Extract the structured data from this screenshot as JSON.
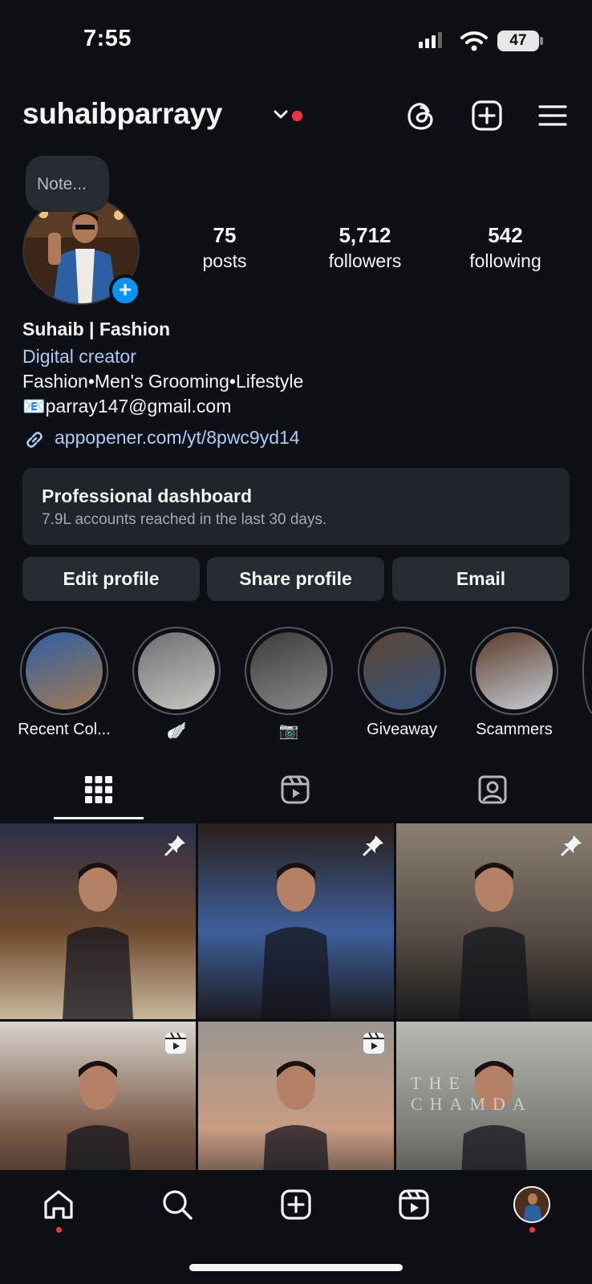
{
  "status_bar": {
    "time": "7:55",
    "battery": "47"
  },
  "header": {
    "username": "suhaibparrayy"
  },
  "note": {
    "placeholder": "Note..."
  },
  "stats": [
    {
      "value": "75",
      "label": "posts"
    },
    {
      "value": "5,712",
      "label": "followers"
    },
    {
      "value": "542",
      "label": "following"
    }
  ],
  "bio": {
    "name": "Suhaib | Fashion",
    "category": "Digital creator",
    "line1": "Fashion•Men's Grooming•Lifestyle",
    "line2": "📧parray147@gmail.com",
    "link": "appopener.com/yt/8pwc9yd14"
  },
  "dashboard": {
    "title": "Professional dashboard",
    "subtitle": "7.9L accounts reached in the last 30 days."
  },
  "buttons": {
    "edit": "Edit profile",
    "share": "Share profile",
    "email": "Email"
  },
  "highlights": [
    {
      "label": "Recent Col...",
      "colors": [
        "#2d5fa0",
        "#a37a55"
      ]
    },
    {
      "label": "🪽",
      "colors": [
        "#6b6f72",
        "#c9c6c0"
      ]
    },
    {
      "label": "📷",
      "colors": [
        "#3b3b3b",
        "#8a8a8a"
      ]
    },
    {
      "label": "Giveaway",
      "colors": [
        "#5d4632",
        "#33527d"
      ]
    },
    {
      "label": "Scammers",
      "colors": [
        "#5a3a25",
        "#c7cdd8"
      ]
    }
  ],
  "grid": [
    {
      "badge": "pin",
      "colors": [
        "#2b2f4a",
        "#6f4a2e",
        "#c8b79a"
      ]
    },
    {
      "badge": "pin",
      "colors": [
        "#2a1e1a",
        "#3d5f9a",
        "#1c1a1c"
      ]
    },
    {
      "badge": "pin",
      "colors": [
        "#8a7f72",
        "#5a4f47",
        "#1a1a1a"
      ]
    },
    {
      "badge": "reel",
      "colors": [
        "#d8d3cc",
        "#7a5a48",
        "#2a2220"
      ]
    },
    {
      "badge": "reel",
      "colors": [
        "#9a9590",
        "#c89c82",
        "#1e1e20"
      ]
    },
    {
      "badge": "none",
      "colors": [
        "#b9b9b4",
        "#7e7e78",
        "#3e3a36"
      ]
    }
  ],
  "grid_text": {
    "watermark": "THE CHAMDA"
  },
  "colors": {
    "accent": "#0095f6",
    "link": "#a8cdf5",
    "notification": "#ff3040",
    "background": "#0c0f14"
  }
}
